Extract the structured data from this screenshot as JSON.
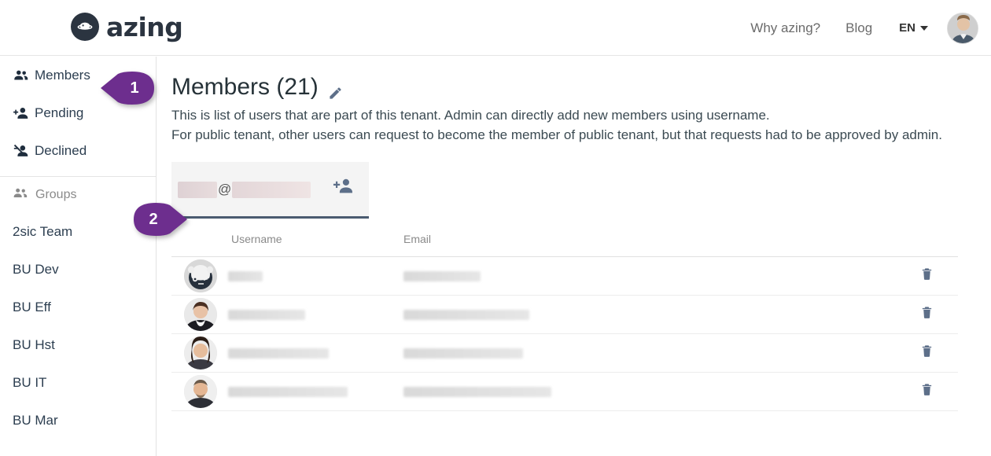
{
  "header": {
    "logo_text": "azing",
    "logo_icon": "azing-planet-icon",
    "nav": [
      {
        "label": "Why azing?",
        "name": "why-azing"
      },
      {
        "label": "Blog",
        "name": "blog"
      }
    ],
    "language": "EN",
    "avatar_alt": "user-avatar"
  },
  "sidebar": {
    "items": [
      {
        "label": "Members",
        "icon": "people-icon"
      },
      {
        "label": "Pending",
        "icon": "person-add-icon"
      },
      {
        "label": "Declined",
        "icon": "person-remove-icon"
      }
    ],
    "groups_label": "Groups",
    "groups_icon": "people-group-icon",
    "groups": [
      {
        "label": "2sic Team"
      },
      {
        "label": "BU Dev"
      },
      {
        "label": "BU Eff"
      },
      {
        "label": "BU Hst"
      },
      {
        "label": "BU IT"
      },
      {
        "label": "BU Mar"
      }
    ]
  },
  "main": {
    "title": "Members (21)",
    "edit_icon": "pencil-icon",
    "description_line1": "This is list of users that are part of this tenant. Admin can directly add new members using username.",
    "description_line2": "For public tenant, other users can request to become the member of public tenant, but that requests had to be approved by admin.",
    "add_member": {
      "input_value": "@",
      "input_redacted": true,
      "button_icon": "person-add-icon"
    },
    "table": {
      "columns": [
        "Username",
        "Email"
      ],
      "rows": [
        {
          "username": "",
          "email": "",
          "avatar": "panda-mask-avatar",
          "redacted": true,
          "action_icon": "trash-icon"
        },
        {
          "username": "",
          "email": "",
          "avatar": "woman-photo-avatar",
          "redacted": true,
          "action_icon": "trash-icon"
        },
        {
          "username": "",
          "email": "",
          "avatar": "woman2-photo-avatar",
          "redacted": true,
          "action_icon": "trash-icon"
        },
        {
          "username": "",
          "email": "",
          "avatar": "man-photo-avatar",
          "redacted": true,
          "action_icon": "trash-icon"
        }
      ]
    }
  },
  "callouts": [
    {
      "number": "1",
      "direction": "left"
    },
    {
      "number": "2",
      "direction": "right"
    }
  ],
  "colors": {
    "callout_purple": "#6d2e8e",
    "icon_slate": "#5d6f89",
    "text_dark": "#2c3e50",
    "muted": "#8a8a8a"
  }
}
